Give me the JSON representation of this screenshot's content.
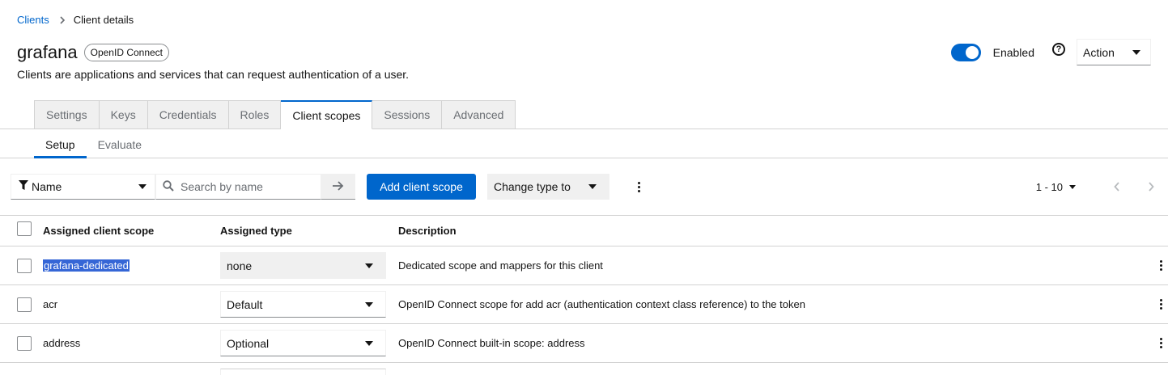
{
  "breadcrumb": {
    "parent": "Clients",
    "current": "Client details"
  },
  "header": {
    "title": "grafana",
    "protocol_badge": "OpenID Connect",
    "subtitle": "Clients are applications and services that can request authentication of a user.",
    "enabled_label": "Enabled",
    "enabled": true,
    "help_icon": "question-circle-icon",
    "action_label": "Action"
  },
  "tabs": [
    {
      "label": "Settings",
      "active": false
    },
    {
      "label": "Keys",
      "active": false
    },
    {
      "label": "Credentials",
      "active": false
    },
    {
      "label": "Roles",
      "active": false
    },
    {
      "label": "Client scopes",
      "active": true
    },
    {
      "label": "Sessions",
      "active": false
    },
    {
      "label": "Advanced",
      "active": false
    }
  ],
  "subtabs": [
    {
      "label": "Setup",
      "active": true
    },
    {
      "label": "Evaluate",
      "active": false
    }
  ],
  "toolbar": {
    "filter_label": "Name",
    "search_placeholder": "Search by name",
    "add_button": "Add client scope",
    "change_type": "Change type to",
    "pagination_range": "1 - 10"
  },
  "table": {
    "headers": {
      "name": "Assigned client scope",
      "type": "Assigned type",
      "description": "Description"
    },
    "rows": [
      {
        "name": "grafana-dedicated",
        "type": "none",
        "description": "Dedicated scope and mappers for this client"
      },
      {
        "name": "acr",
        "type": "Default",
        "description": "OpenID Connect scope for add acr (authentication context class reference) to the token"
      },
      {
        "name": "address",
        "type": "Optional",
        "description": "OpenID Connect built-in scope: address"
      }
    ]
  },
  "colors": {
    "accent": "#0066cc",
    "selection": "#3566d6",
    "border": "#d2d2d2",
    "muted": "#6a6e73"
  }
}
